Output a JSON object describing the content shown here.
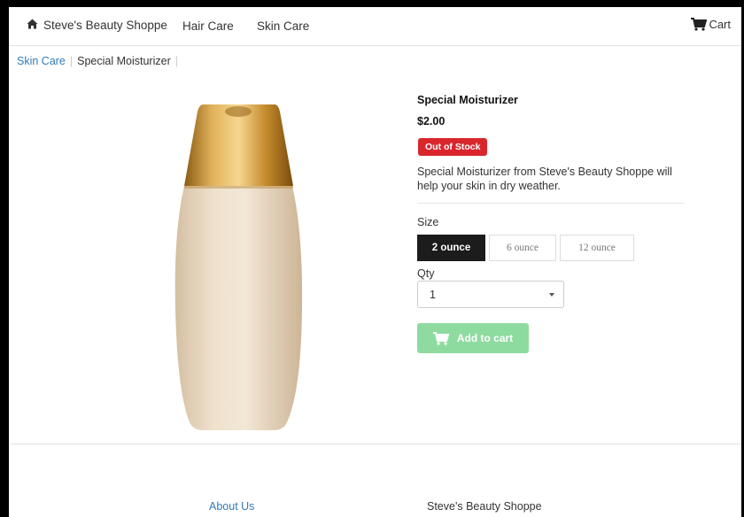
{
  "nav": {
    "brand": "Steve's Beauty Shoppe",
    "brand_icon": "home-icon",
    "links": [
      "Hair Care",
      "Skin Care"
    ],
    "cart_label": "Cart",
    "cart_icon": "shopping-cart-icon"
  },
  "breadcrumb": {
    "parent": "Skin Care",
    "current": "Special Moisturizer"
  },
  "product": {
    "name": "Special Moisturizer",
    "price": "$2.00",
    "stock_status": "Out of Stock",
    "stock_color": "#d9262c",
    "description": "Special Moisturizer from Steve's Beauty Shoppe will help your skin in dry weather.",
    "image": "moisturizer-bottle-image"
  },
  "options": {
    "size_label": "Size",
    "sizes": [
      "2 ounce",
      "6 ounce",
      "12 ounce"
    ],
    "selected_size": "2 ounce",
    "qty_label": "Qty",
    "qty_value": "1",
    "add_to_cart_label": "Add to cart",
    "add_to_cart_color": "#8edb9f"
  },
  "footer": {
    "about_link": "About Us",
    "store_name": "Steve's Beauty Shoppe"
  }
}
